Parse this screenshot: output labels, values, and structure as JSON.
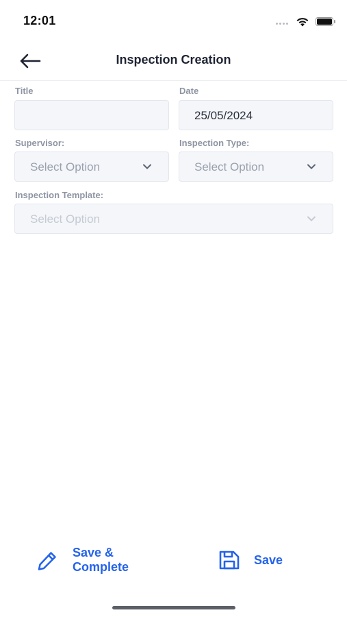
{
  "status_bar": {
    "time": "12:01"
  },
  "header": {
    "title": "Inspection Creation"
  },
  "form": {
    "title": {
      "label": "Title",
      "value": ""
    },
    "date": {
      "label": "Date",
      "value": "25/05/2024"
    },
    "supervisor": {
      "label": "Supervisor:",
      "placeholder": "Select Option"
    },
    "inspection_type": {
      "label": "Inspection Type:",
      "placeholder": "Select Option"
    },
    "inspection_template": {
      "label": "Inspection Template:",
      "placeholder": "Select Option",
      "disabled": true
    }
  },
  "actions": {
    "save_complete_line1": "Save &",
    "save_complete_line2": "Complete",
    "save": "Save"
  },
  "colors": {
    "accent": "#2563eb",
    "field_bg": "#f4f6fa",
    "label": "#8e94a3"
  },
  "icons": [
    "back-arrow-icon",
    "wifi-icon",
    "battery-icon",
    "chevron-down-icon",
    "pencil-icon",
    "floppy-disk-icon"
  ]
}
